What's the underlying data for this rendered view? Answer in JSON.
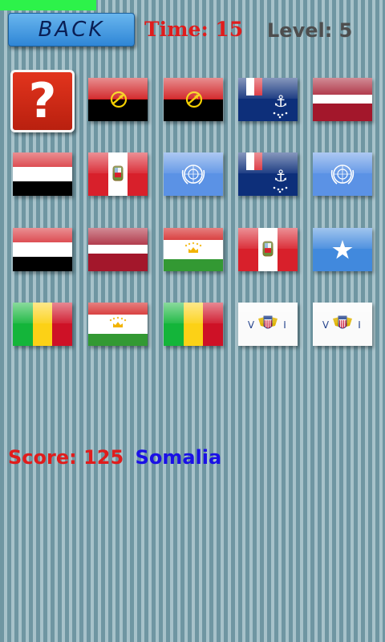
{
  "header": {
    "back_label": "BACK",
    "time_text": "Time: 15",
    "level_text": "Level: 5",
    "progress_fraction": 0.25
  },
  "grid": {
    "rows": [
      [
        "question-card",
        "angola",
        "angola",
        "french-southern-territories",
        "latvia"
      ],
      [
        "yemen",
        "peru",
        "united-nations",
        "french-southern-territories",
        "united-nations"
      ],
      [
        "yemen",
        "latvia",
        "tajikistan",
        "peru",
        "somalia"
      ],
      [
        "mali",
        "tajikistan",
        "mali",
        "us-virgin-islands",
        "us-virgin-islands"
      ]
    ],
    "question_card_symbol": "?",
    "vi_letter_left": "V",
    "vi_letter_right": "I"
  },
  "footer": {
    "score_text": "Score: 125",
    "target_country": "Somalia"
  },
  "colors": {
    "time": "#e01c1c",
    "level": "#4d4d4d",
    "score": "#e01c1c",
    "country": "#1a10e6",
    "progress": "#2df24a",
    "back_button": "#4a9fe0"
  }
}
